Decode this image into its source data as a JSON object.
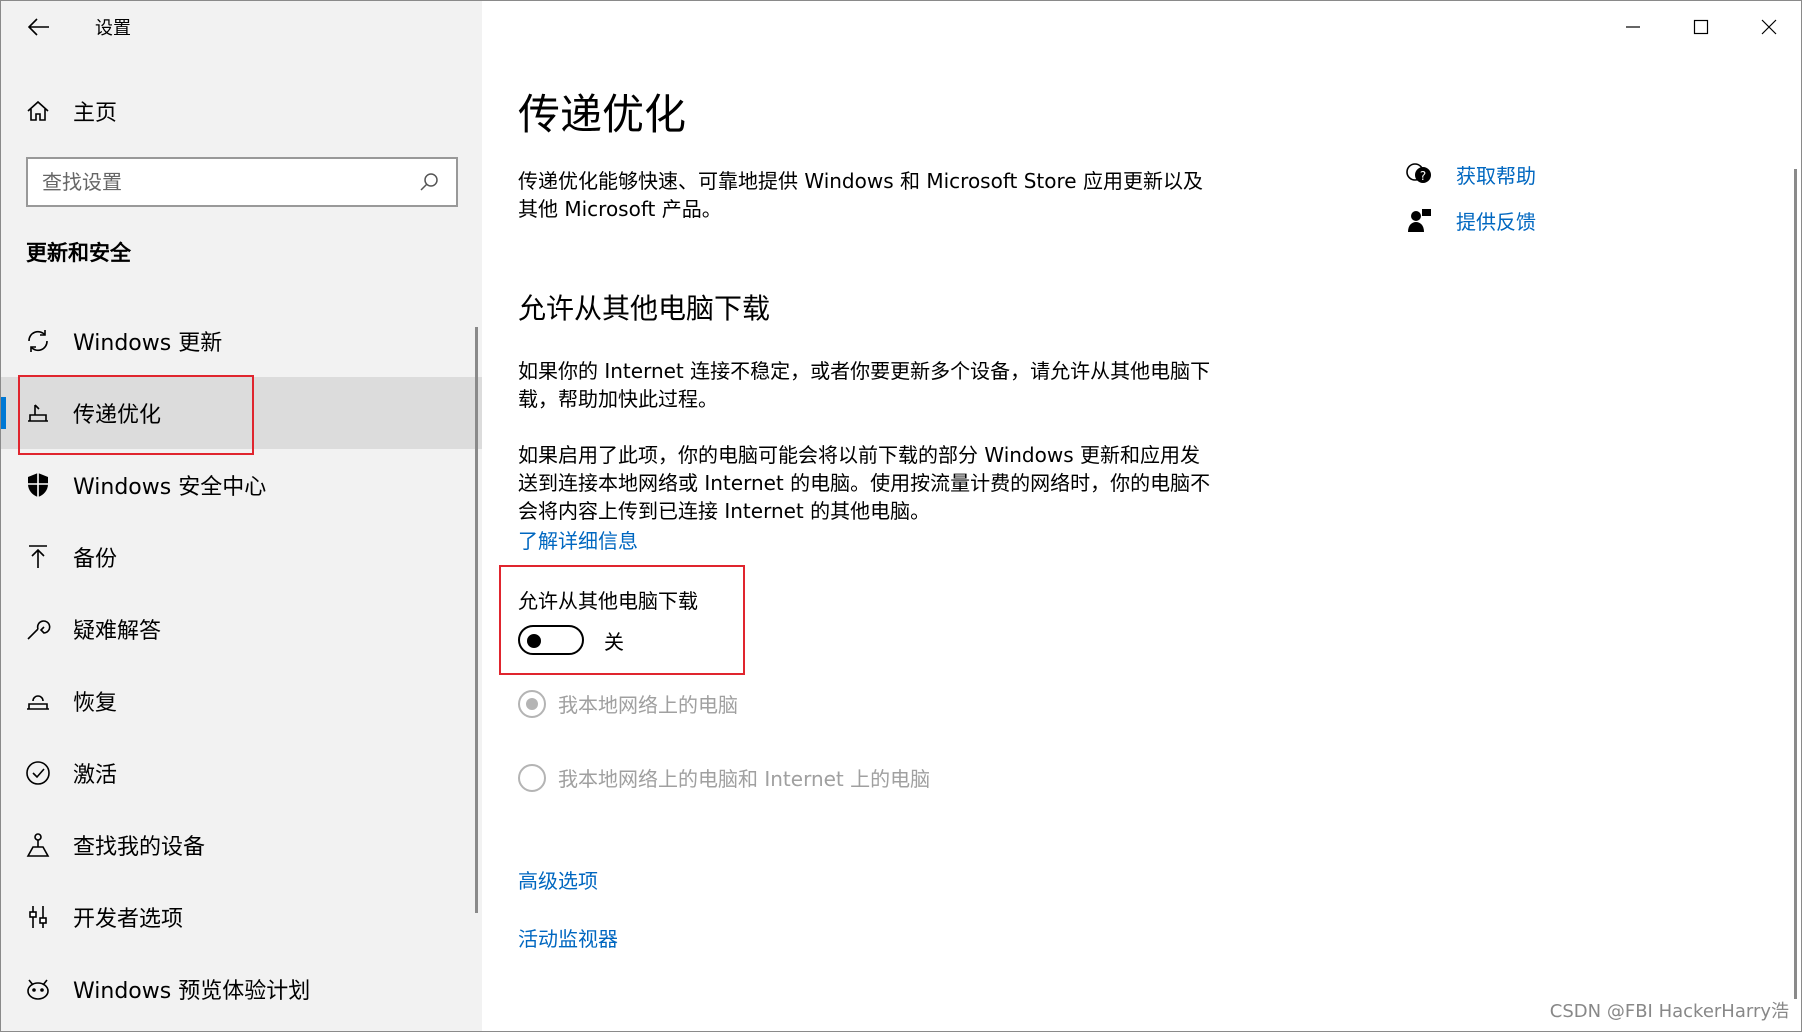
{
  "window": {
    "title": "设置"
  },
  "sidebar": {
    "home_label": "主页",
    "search_placeholder": "查找设置",
    "section_heading": "更新和安全",
    "items": [
      {
        "label": "Windows 更新",
        "icon": "refresh-icon"
      },
      {
        "label": "传递优化",
        "icon": "delivery-optimization-icon",
        "active": true
      },
      {
        "label": "Windows 安全中心",
        "icon": "shield-icon"
      },
      {
        "label": "备份",
        "icon": "upload-arrow-icon"
      },
      {
        "label": "疑难解答",
        "icon": "wrench-icon"
      },
      {
        "label": "恢复",
        "icon": "recovery-icon"
      },
      {
        "label": "激活",
        "icon": "check-circle-icon"
      },
      {
        "label": "查找我的设备",
        "icon": "find-device-icon"
      },
      {
        "label": "开发者选项",
        "icon": "developer-icon"
      },
      {
        "label": "Windows 预览体验计划",
        "icon": "insider-icon"
      }
    ]
  },
  "main": {
    "title": "传递优化",
    "description": "传递优化能够快速、可靠地提供 Windows 和 Microsoft Store 应用更新以及其他 Microsoft 产品。",
    "subheading": "允许从其他电脑下载",
    "paragraph1": "如果你的 Internet 连接不稳定，或者你要更新多个设备，请允许从其他电脑下载，帮助加快此过程。",
    "paragraph2": "如果启用了此项，你的电脑可能会将以前下载的部分 Windows 更新和应用发送到连接本地网络或 Internet 的电脑。使用按流量计费的网络时，你的电脑不会将内容上传到已连接 Internet 的其他电脑。",
    "learn_more": "了解详细信息",
    "toggle_label": "允许从其他电脑下载",
    "toggle_state": "关",
    "toggle_on": false,
    "radio_options": [
      {
        "label": "我本地网络上的电脑",
        "checked": true
      },
      {
        "label": "我本地网络上的电脑和 Internet 上的电脑",
        "checked": false
      }
    ],
    "advanced_options": "高级选项",
    "activity_monitor": "活动监视器"
  },
  "help": {
    "get_help": "获取帮助",
    "give_feedback": "提供反馈"
  },
  "watermark": "CSDN @FBI HackerHarry浩",
  "colors": {
    "accent": "#0078d4",
    "link": "#0067c0",
    "highlight": "#e0252e",
    "sidebar_bg": "#f2f2f2",
    "active_item_bg": "#dcdcdc"
  }
}
